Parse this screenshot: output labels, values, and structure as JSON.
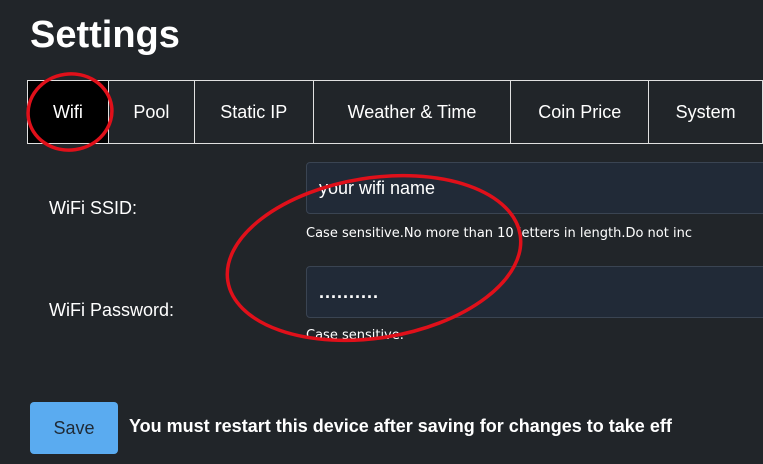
{
  "header": {
    "title": "Settings"
  },
  "tabs": [
    {
      "label": "Wifi",
      "active": true
    },
    {
      "label": "Pool",
      "active": false
    },
    {
      "label": "Static IP",
      "active": false
    },
    {
      "label": "Weather & Time",
      "active": false
    },
    {
      "label": "Coin Price",
      "active": false
    },
    {
      "label": "System",
      "active": false
    }
  ],
  "wifi": {
    "ssid_label": "WiFi SSID:",
    "ssid_placeholder": "your wifi name",
    "ssid_help": "Case sensitive.No more than 10 letters in length.Do not inc",
    "password_label": "WiFi Password:",
    "password_value": "..........",
    "password_help": "Case sensitive."
  },
  "footer": {
    "save_label": "Save",
    "restart_note": "You must restart this device after saving for changes to take eff"
  },
  "colors": {
    "background": "#212529",
    "active_tab": "#000000",
    "save_button": "#5aabf0",
    "annotation": "#e0101a"
  }
}
